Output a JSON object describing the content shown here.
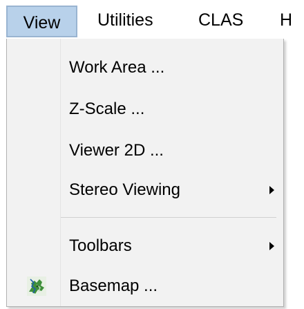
{
  "menubar": {
    "items": [
      {
        "label": "View"
      },
      {
        "label": "Utilities"
      },
      {
        "label": "CLAS"
      },
      {
        "label": "H"
      }
    ]
  },
  "view_menu": {
    "items": [
      {
        "label": "Work Area ...",
        "has_submenu": false
      },
      {
        "label": "Z-Scale ...",
        "has_submenu": false
      },
      {
        "label": "Viewer 2D ...",
        "has_submenu": false
      },
      {
        "label": "Stereo Viewing",
        "has_submenu": true
      },
      {
        "label": "Toolbars",
        "has_submenu": true
      },
      {
        "label": "Basemap ...",
        "has_submenu": false,
        "icon": "basemap-icon"
      }
    ]
  },
  "colors": {
    "active_menu_bg": "#b8d1ea",
    "active_menu_border": "#99b4d1",
    "dropdown_bg": "#f2f2f2"
  }
}
